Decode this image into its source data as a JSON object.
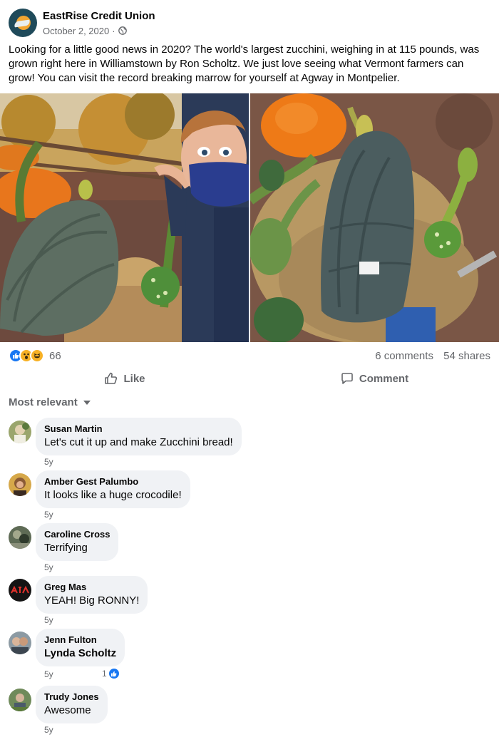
{
  "post": {
    "page_name": "EastRise Credit Union",
    "date": "October 2, 2020",
    "separator": "·",
    "text": "Looking for a little good news in 2020? The world's largest zucchini, weighing in at 115 pounds, was grown right here in Williamstown by Ron Scholtz. We just love seeing what Vermont farmers can grow! You can visit the record breaking marrow for yourself at Agway in Montpelier.",
    "privacy_icon": "globe-icon"
  },
  "stats": {
    "reaction_icons": [
      "like-reaction-icon",
      "wow-reaction-icon",
      "haha-reaction-icon"
    ],
    "reaction_count": "66",
    "comments": "6 comments",
    "shares": "54 shares"
  },
  "actions": {
    "like_label": "Like",
    "comment_label": "Comment"
  },
  "comments_filter": "Most relevant",
  "comments": [
    {
      "name": "Susan Martin",
      "text": "Let's cut it up and make Zucchini bread!",
      "time": "5y"
    },
    {
      "name": "Amber Gest Palumbo",
      "text": "It looks like a huge crocodile!",
      "time": "5y"
    },
    {
      "name": "Caroline Cross",
      "text": "Terrifying",
      "time": "5y"
    },
    {
      "name": "Greg Mas",
      "text": "YEAH! Big RONNY!",
      "time": "5y"
    },
    {
      "name": "Jenn Fulton",
      "text": "Lynda Scholtz",
      "time": "5y",
      "likes": "1"
    },
    {
      "name": "Trudy Jones",
      "text": "Awesome",
      "time": "5y"
    }
  ],
  "colors": {
    "accent": "#1877f2",
    "secondary_text": "#65676b",
    "bubble": "#f0f2f5"
  }
}
